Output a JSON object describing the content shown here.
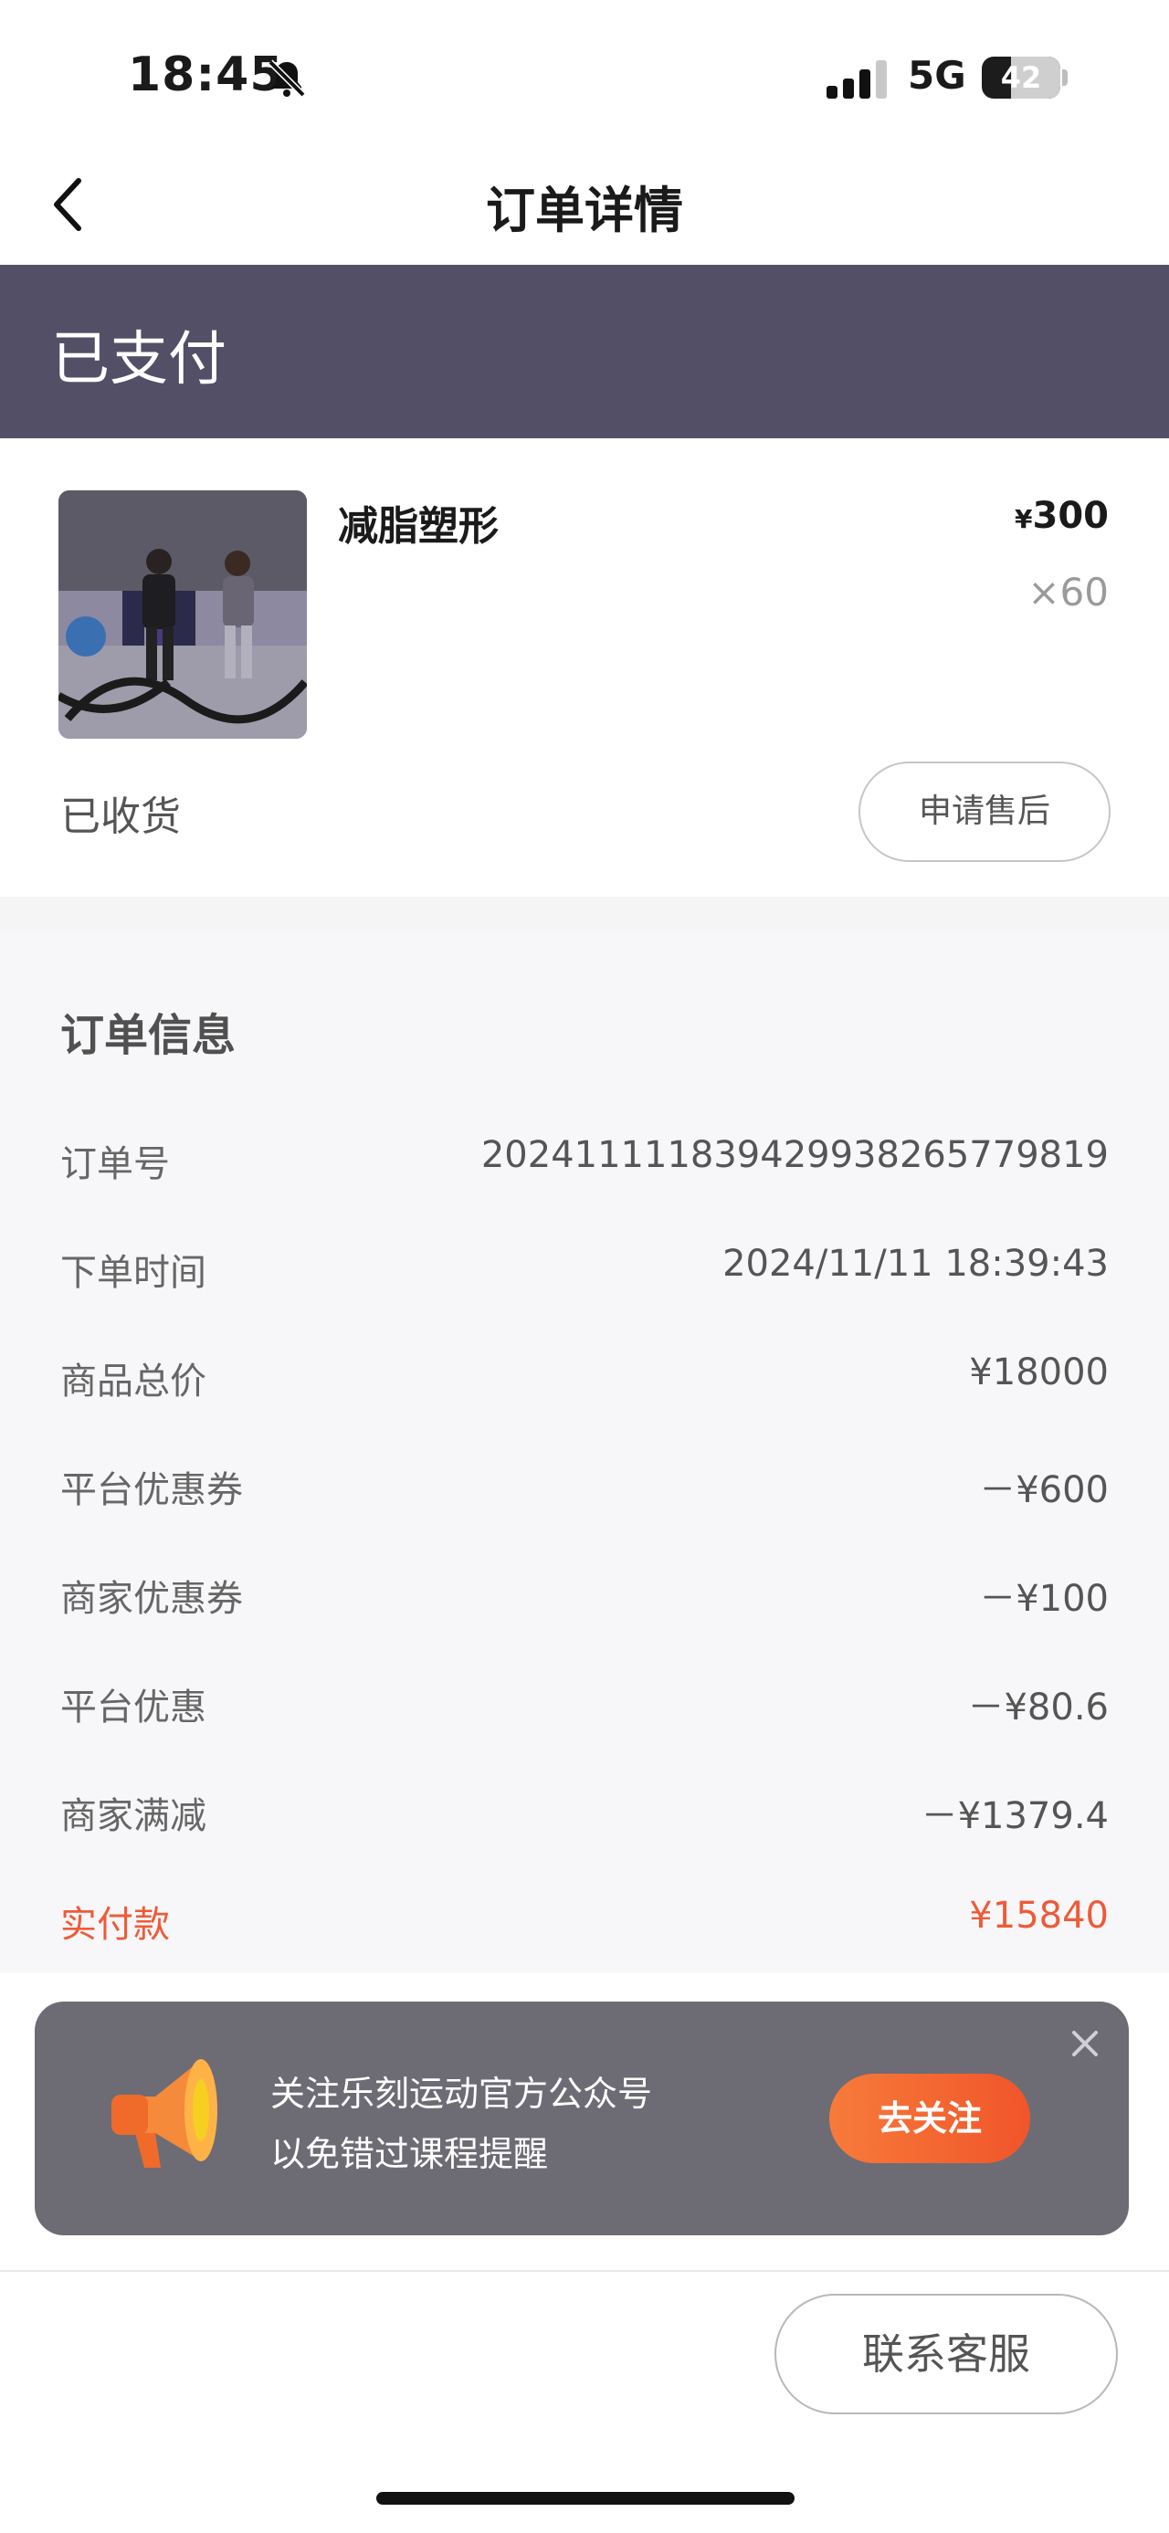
{
  "status_bar": {
    "time": "18:45",
    "network": "5G",
    "battery": "42"
  },
  "nav": {
    "title": "订单详情"
  },
  "order_status": "已支付",
  "product": {
    "name": "减脂塑形",
    "price_symbol": "¥",
    "price": "300",
    "quantity": "×60",
    "delivery_status": "已收货",
    "after_sale_label": "申请售后"
  },
  "order_info": {
    "title": "订单信息",
    "rows": [
      {
        "label": "订单号",
        "value": "2024111118394299382657798​19"
      },
      {
        "label": "下单时间",
        "value": "2024/11/11 18:39:43"
      },
      {
        "label": "商品总价",
        "value": "¥18000"
      },
      {
        "label": "平台优惠券",
        "value": "－¥600"
      },
      {
        "label": "商家优惠券",
        "value": "－¥100"
      },
      {
        "label": "平台优惠",
        "value": "－¥80.6"
      },
      {
        "label": "商家满减",
        "value": "－¥1379.4"
      },
      {
        "label": "实付款",
        "value": "¥15840"
      }
    ]
  },
  "follow_popup": {
    "line1": "关注乐刻运动官方公众号",
    "line2": "以免错过课程提醒",
    "button": "去关注"
  },
  "contact_service": "联系客服",
  "colors": {
    "banner": "#524f66",
    "accent": "#ef5a38"
  },
  "icons": [
    "bell-slash-icon",
    "signal-icon",
    "battery-icon",
    "back-chevron-icon",
    "megaphone-icon",
    "close-icon"
  ]
}
